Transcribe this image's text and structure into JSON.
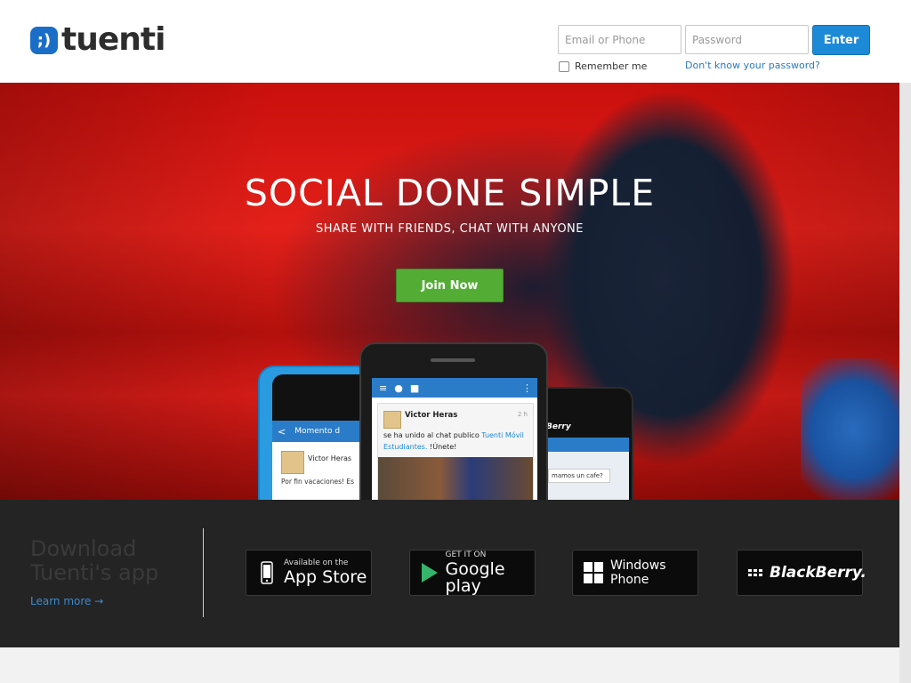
{
  "header": {
    "logo_text": "tuenti",
    "logo_mark": ";)",
    "email_placeholder": "Email or Phone",
    "password_placeholder": "Password",
    "enter_label": "Enter",
    "remember_label": "Remember me",
    "forgot_label": "Don't know your password?"
  },
  "hero": {
    "title": "SOCIAL DONE SIMPLE",
    "subtitle": "SHARE WITH FRIENDS, CHAT WITH ANYONE",
    "join_label": "Join Now"
  },
  "phones": {
    "left": {
      "bar_title": "Momento d",
      "user": "Victor Heras",
      "post": "Por fin vacaciones! Es"
    },
    "center": {
      "user": "Victor Heras",
      "time": "2 h",
      "message_pre": "se ha unido al chat publico",
      "message_link": "Tuenti Móvil Estudiantes.",
      "message_post": "!Únete!"
    },
    "right": {
      "brand": "Berry",
      "bubble": "mamos un cafe?"
    }
  },
  "download": {
    "title": "Download Tuenti's app",
    "learn_more": "Learn more →",
    "stores": {
      "apple_small": "Available on the",
      "apple_big": "App Store",
      "google_small": "GET IT ON",
      "google_big": "Google play",
      "windows_line1": "Windows",
      "windows_line2": "Phone",
      "blackberry": "BlackBerry."
    }
  },
  "colors": {
    "brand_blue": "#1a6ec8",
    "enter_button": "#1d8ad8",
    "join_button": "#53ad34",
    "download_bg": "#242424"
  }
}
